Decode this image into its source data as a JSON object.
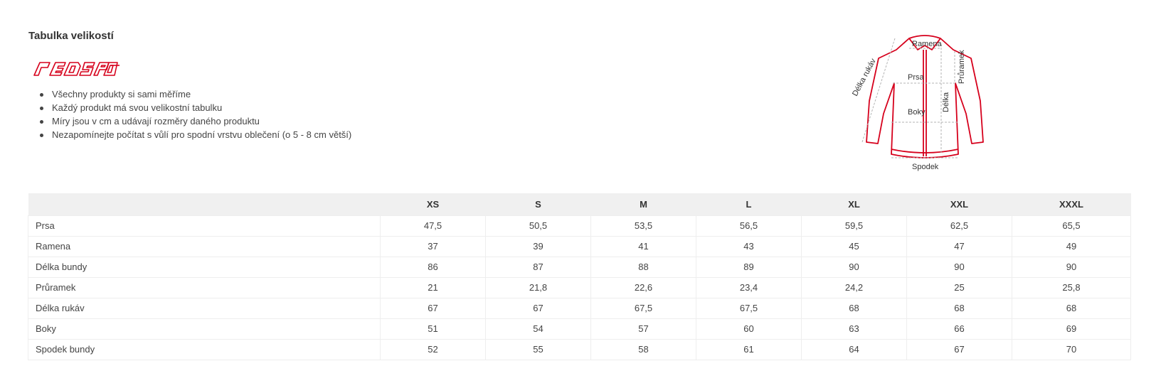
{
  "page": {
    "title": "Tabulka velikostí",
    "brand": "REDSPOT"
  },
  "notes": [
    "Všechny produkty si sami měříme",
    "Každý produkt má svou velikostní tabulku",
    "Míry jsou v cm a udávají rozměry daného produktu",
    "Nezapomínejte počítat s vůlí pro spodní vrstvu oblečení (o 5 - 8 cm větší)"
  ],
  "diagram": {
    "labels": {
      "ramena": "Ramena",
      "prsa": "Prsa",
      "boky": "Boky",
      "spodek": "Spodek",
      "delka": "Délka",
      "delka_rukav": "Délka rukáv",
      "pruramek": "Průramek"
    },
    "colors": {
      "outline": "#d6001c",
      "arrows": "#b3b3b3"
    }
  },
  "table": {
    "headers": [
      "",
      "XS",
      "S",
      "M",
      "L",
      "XL",
      "XXL",
      "XXXL"
    ],
    "rows": [
      {
        "label": "Prsa",
        "values": [
          "47,5",
          "50,5",
          "53,5",
          "56,5",
          "59,5",
          "62,5",
          "65,5"
        ]
      },
      {
        "label": "Ramena",
        "values": [
          "37",
          "39",
          "41",
          "43",
          "45",
          "47",
          "49"
        ]
      },
      {
        "label": "Délka bundy",
        "values": [
          "86",
          "87",
          "88",
          "89",
          "90",
          "90",
          "90"
        ]
      },
      {
        "label": "Průramek",
        "values": [
          "21",
          "21,8",
          "22,6",
          "23,4",
          "24,2",
          "25",
          "25,8"
        ]
      },
      {
        "label": "Délka rukáv",
        "values": [
          "67",
          "67",
          "67,5",
          "67,5",
          "68",
          "68",
          "68"
        ]
      },
      {
        "label": "Boky",
        "values": [
          "51",
          "54",
          "57",
          "60",
          "63",
          "66",
          "69"
        ]
      },
      {
        "label": "Spodek bundy",
        "values": [
          "52",
          "55",
          "58",
          "61",
          "64",
          "67",
          "70"
        ]
      }
    ]
  },
  "colors": {
    "header_bg": "#f0f0f0",
    "border": "#eeeeee",
    "brand_red": "#d6001c"
  }
}
